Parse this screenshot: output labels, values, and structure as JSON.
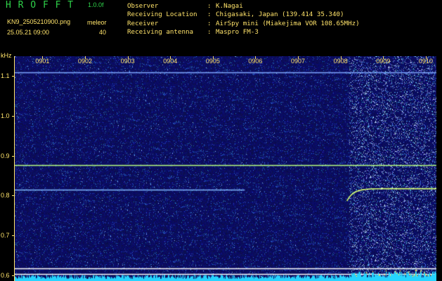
{
  "header": {
    "app_name": "H R O F F T",
    "version": "1.0.0f",
    "file_name": "KN9_2505210900.png",
    "date_time": "25.05.21 09:00",
    "mode_label": "meleor",
    "mode_value": "40"
  },
  "info": {
    "observer_label": "Observer",
    "observer_value": "K.Nagai",
    "location_label": "Receiving Location",
    "location_value": "Chigasaki, Japan (139.414 35.340)",
    "receiver_label": "Receiver",
    "receiver_value": "AirSpy mini (Miakejima VOR 108.65MHz)",
    "antenna_label": "Receiving antenna",
    "antenna_value": "Maspro FM-3",
    "separator": ":"
  },
  "chart_data": {
    "type": "heatmap",
    "y_unit": "kHz",
    "x_tick_labels": [
      "0901",
      "0902",
      "0903",
      "0904",
      "0905",
      "0906",
      "0907",
      "0908",
      "0909",
      "0910"
    ],
    "y_tick_labels": [
      "1.1",
      "1.0",
      "0.9",
      "0.8",
      "0.7",
      "0.6"
    ],
    "y_ticks": [
      1.1,
      1.0,
      0.9,
      0.8,
      0.7,
      0.6
    ],
    "x_ticks_minutes": [
      1,
      2,
      3,
      4,
      5,
      6,
      7,
      8,
      9,
      10
    ],
    "xlim_minutes": [
      0.35,
      10.25
    ],
    "ylim_khz": [
      0.585,
      1.15
    ],
    "carrier_lines_khz": [
      {
        "freq": 1.11,
        "start_minute": 0.35,
        "end_minute": 10.25,
        "color": "#7fa8ff"
      },
      {
        "freq": 0.877,
        "start_minute": 0.35,
        "end_minute": 10.25,
        "color": "#b8ff80"
      },
      {
        "freq": 0.815,
        "start_minute": 0.35,
        "end_minute": 5.75,
        "color": "#7fb8ff"
      },
      {
        "freq": 0.617,
        "start_minute": 0.35,
        "end_minute": 10.25,
        "color": "#ffffff"
      },
      {
        "freq": 0.603,
        "start_minute": 0.35,
        "end_minute": 10.25,
        "color": "#ffffff"
      }
    ],
    "meteor_trace": {
      "start_minute": 8.15,
      "end_minute": 10.25,
      "start_freq_khz": 0.786,
      "end_freq_khz": 0.817,
      "color": "#d8ff70"
    },
    "noise_band_minutes": [
      8.2,
      10.25
    ],
    "background_color": "#0a0a6a",
    "signal_bar_color": "#26d4ff"
  }
}
